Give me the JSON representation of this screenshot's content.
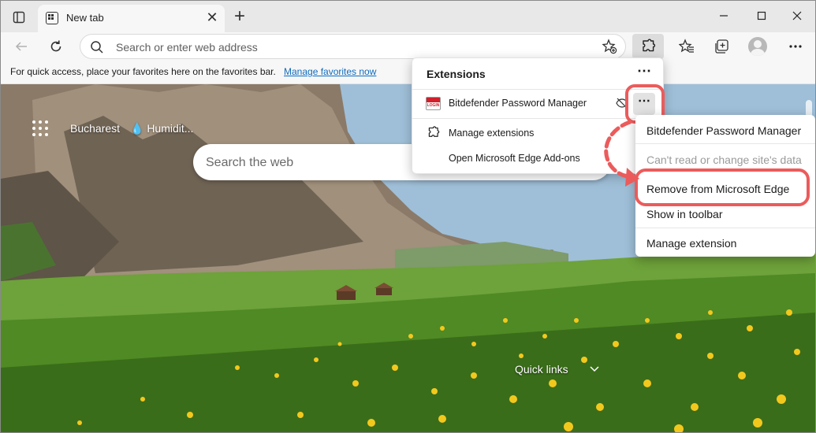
{
  "browser": {
    "tab": {
      "title": "New tab",
      "close_label": "✕"
    },
    "new_tab_label": "+",
    "window": {
      "minimize": "—",
      "maximize": "☐",
      "close": "✕"
    }
  },
  "navbar": {
    "address_placeholder": "Search or enter web address"
  },
  "favorites_bar": {
    "message": "For quick access, place your favorites here on the favorites bar.",
    "link": "Manage favorites now"
  },
  "newtab_page": {
    "weather_city": "Bucharest",
    "weather_detail": "💧 Humidit...",
    "search_placeholder": "Search the web",
    "quick_links": "Quick links"
  },
  "extensions_popup": {
    "title": "Extensions",
    "more": "⋯",
    "items": [
      {
        "label": "Bitdefender Password Manager"
      }
    ],
    "row_more": "⋯",
    "manage": "Manage extensions",
    "addons": "Open Microsoft Edge Add-ons"
  },
  "context_menu": {
    "items": [
      {
        "label": "Bitdefender Password Manager",
        "disabled": false
      },
      {
        "label": "Can't read or change site's data",
        "disabled": true
      },
      {
        "label": "Remove from Microsoft Edge",
        "disabled": false
      },
      {
        "label": "Show in toolbar",
        "disabled": false
      },
      {
        "label": "Manage extension",
        "disabled": false
      }
    ]
  },
  "annotation": {
    "highlight_color": "#ec5b5b"
  }
}
